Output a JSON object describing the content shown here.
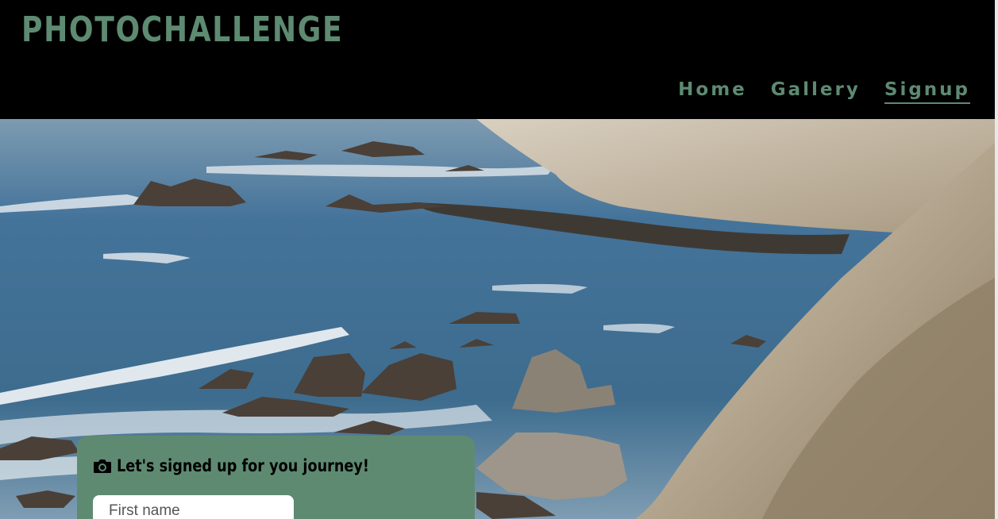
{
  "header": {
    "brand": "PHOTOCHALLENGE",
    "nav": [
      {
        "label": "Home",
        "active": false
      },
      {
        "label": "Gallery",
        "active": false
      },
      {
        "label": "Signup",
        "active": true
      }
    ]
  },
  "hero": {
    "image": "coastal cliffs and ocean waves photograph"
  },
  "signup_form": {
    "icon": "camera-icon",
    "title": "Let's signed up for you journey!",
    "first_name_placeholder": "First name"
  },
  "colors": {
    "accent": "#5e8a72",
    "header_bg": "#000000"
  }
}
